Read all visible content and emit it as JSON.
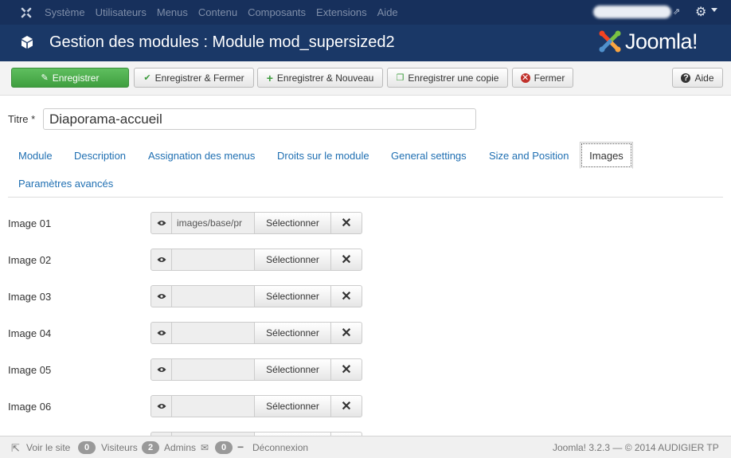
{
  "topnav": {
    "menu": [
      "Système",
      "Utilisateurs",
      "Menus",
      "Contenu",
      "Composants",
      "Extensions",
      "Aide"
    ]
  },
  "header": {
    "title": "Gestion des modules : Module mod_supersized2",
    "brand": "Joomla!"
  },
  "toolbar": {
    "save": "Enregistrer",
    "save_close": "Enregistrer & Fermer",
    "save_new": "Enregistrer & Nouveau",
    "save_copy": "Enregistrer une copie",
    "close": "Fermer",
    "help": "Aide"
  },
  "form": {
    "title_label": "Titre *",
    "title_value": "Diaporama-accueil"
  },
  "tabs": [
    "Module",
    "Description",
    "Assignation des menus",
    "Droits sur le module",
    "General settings",
    "Size and Position",
    "Images",
    "Paramètres avancés"
  ],
  "images": [
    {
      "label": "Image 01",
      "path": "images/base/pr"
    },
    {
      "label": "Image 02",
      "path": ""
    },
    {
      "label": "Image 03",
      "path": ""
    },
    {
      "label": "Image 04",
      "path": ""
    },
    {
      "label": "Image 05",
      "path": ""
    },
    {
      "label": "Image 06",
      "path": ""
    }
  ],
  "media_select": "Sélectionner",
  "status": {
    "view_site": "Voir le site",
    "visitors_count": "0",
    "visitors": "Visiteurs",
    "admins_count": "2",
    "admins": "Admins",
    "messages_count": "0",
    "logout": "Déconnexion",
    "footer": "Joomla! 3.2.3  —  © 2014 AUDIGIER TP"
  }
}
